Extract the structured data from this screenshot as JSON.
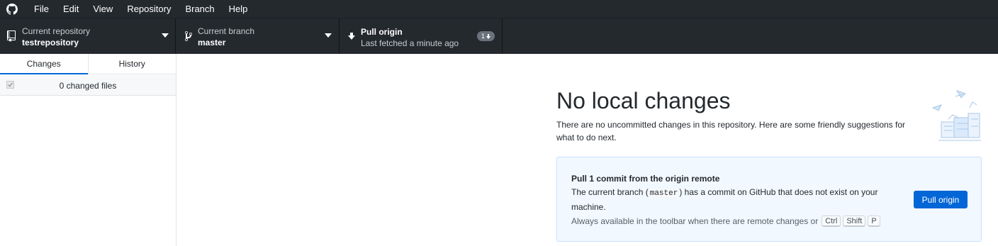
{
  "menubar": {
    "logo_icon": "github-icon",
    "items": [
      "File",
      "Edit",
      "View",
      "Repository",
      "Branch",
      "Help"
    ]
  },
  "toolbar": {
    "repository": {
      "label": "Current repository",
      "value": "testrepository",
      "icon": "repo-icon"
    },
    "branch": {
      "label": "Current branch",
      "value": "master",
      "icon": "branch-icon"
    },
    "pull": {
      "label": "Pull origin",
      "sub": "Last fetched a minute ago",
      "icon": "arrow-down-icon",
      "badge": "1"
    }
  },
  "sidebar": {
    "tabs": [
      "Changes",
      "History"
    ],
    "selected_tab": "Changes",
    "changed_files": "0 changed files"
  },
  "main": {
    "title": "No local changes",
    "description": "There are no uncommitted changes in this repository. Here are some friendly suggestions for what to do next.",
    "card": {
      "title": "Pull 1 commit from the origin remote",
      "desc_before": "The current branch (",
      "branch": "master",
      "desc_after": ") has a commit on GitHub that does not exist on your machine.",
      "hint": "Always available in the toolbar when there are remote changes or",
      "keys": [
        "Ctrl",
        "Shift",
        "P"
      ],
      "button": "Pull origin"
    }
  },
  "colors": {
    "toolbar_bg": "#24292e",
    "accent": "#0366d6",
    "card_bg": "#f1f8ff",
    "card_border": "#c8e1ff"
  }
}
